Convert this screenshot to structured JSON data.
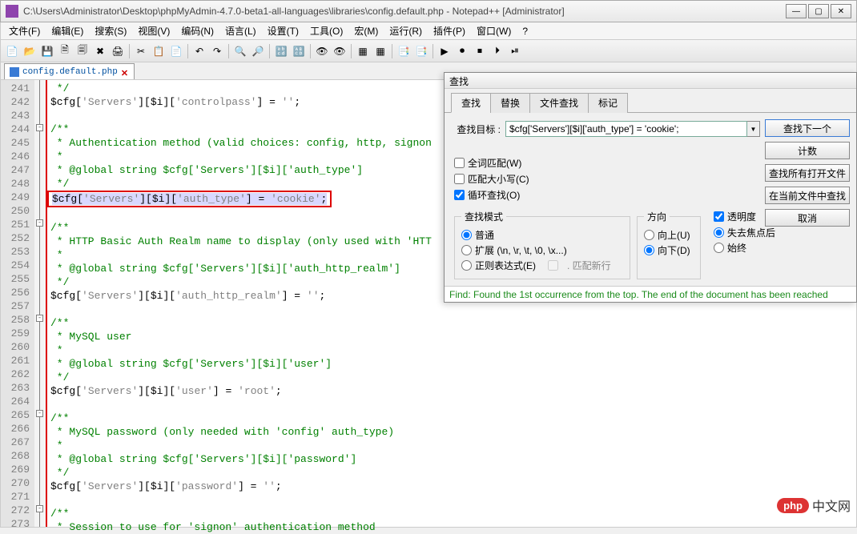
{
  "window": {
    "title": "C:\\Users\\Administrator\\Desktop\\phpMyAdmin-4.7.0-beta1-all-languages\\libraries\\config.default.php - Notepad++ [Administrator]"
  },
  "menu": [
    "文件(F)",
    "编辑(E)",
    "搜索(S)",
    "视图(V)",
    "编码(N)",
    "语言(L)",
    "设置(T)",
    "工具(O)",
    "宏(M)",
    "运行(R)",
    "插件(P)",
    "窗口(W)",
    "?"
  ],
  "tab": {
    "filename": "config.default.php"
  },
  "lines": {
    "start": 241,
    "rows": [
      {
        "n": 241,
        "t": "com",
        "txt": " */"
      },
      {
        "n": 242,
        "t": "code",
        "txt": "$cfg['Servers'][$i]['controlpass'] = '';"
      },
      {
        "n": 243,
        "t": "blank",
        "txt": ""
      },
      {
        "n": 244,
        "t": "com",
        "fold": true,
        "txt": "/**"
      },
      {
        "n": 245,
        "t": "com",
        "txt": " * Authentication method (valid choices: config, http, signon"
      },
      {
        "n": 246,
        "t": "com",
        "txt": " *"
      },
      {
        "n": 247,
        "t": "com",
        "txt": " * @global string $cfg['Servers'][$i]['auth_type']"
      },
      {
        "n": 248,
        "t": "com",
        "txt": " */"
      },
      {
        "n": 249,
        "t": "hl",
        "txt": "$cfg['Servers'][$i]['auth_type'] = 'cookie';"
      },
      {
        "n": 250,
        "t": "blank",
        "txt": ""
      },
      {
        "n": 251,
        "t": "com",
        "fold": true,
        "txt": "/**"
      },
      {
        "n": 252,
        "t": "com",
        "txt": " * HTTP Basic Auth Realm name to display (only used with 'HTT"
      },
      {
        "n": 253,
        "t": "com",
        "txt": " *"
      },
      {
        "n": 254,
        "t": "com",
        "txt": " * @global string $cfg['Servers'][$i]['auth_http_realm']"
      },
      {
        "n": 255,
        "t": "com",
        "txt": " */"
      },
      {
        "n": 256,
        "t": "code",
        "txt": "$cfg['Servers'][$i]['auth_http_realm'] = '';"
      },
      {
        "n": 257,
        "t": "blank",
        "txt": ""
      },
      {
        "n": 258,
        "t": "com",
        "fold": true,
        "txt": "/**"
      },
      {
        "n": 259,
        "t": "com",
        "txt": " * MySQL user"
      },
      {
        "n": 260,
        "t": "com",
        "txt": " *"
      },
      {
        "n": 261,
        "t": "com",
        "txt": " * @global string $cfg['Servers'][$i]['user']"
      },
      {
        "n": 262,
        "t": "com",
        "txt": " */"
      },
      {
        "n": 263,
        "t": "code",
        "txt": "$cfg['Servers'][$i]['user'] = 'root';"
      },
      {
        "n": 264,
        "t": "blank",
        "txt": ""
      },
      {
        "n": 265,
        "t": "com",
        "fold": true,
        "txt": "/**"
      },
      {
        "n": 266,
        "t": "com",
        "txt": " * MySQL password (only needed with 'config' auth_type)"
      },
      {
        "n": 267,
        "t": "com",
        "txt": " *"
      },
      {
        "n": 268,
        "t": "com",
        "txt": " * @global string $cfg['Servers'][$i]['password']"
      },
      {
        "n": 269,
        "t": "com",
        "txt": " */"
      },
      {
        "n": 270,
        "t": "code",
        "txt": "$cfg['Servers'][$i]['password'] = '';"
      },
      {
        "n": 271,
        "t": "blank",
        "txt": ""
      },
      {
        "n": 272,
        "t": "com",
        "fold": true,
        "txt": "/**"
      },
      {
        "n": 273,
        "t": "com",
        "txt": " * Session to use for 'signon' authentication method"
      }
    ]
  },
  "find": {
    "title": "查找",
    "tabs": [
      "查找",
      "替换",
      "文件查找",
      "标记"
    ],
    "target_label": "查找目标 :",
    "target_value": "$cfg['Servers'][$i]['auth_type'] = 'cookie';",
    "buttons": {
      "next": "查找下一个",
      "count": "计数",
      "all_open": "查找所有打开文件",
      "in_current": "在当前文件中查找",
      "close": "取消"
    },
    "checks": {
      "whole": "全词匹配(W)",
      "case": "匹配大小写(C)",
      "wrap": "循环查找(O)"
    },
    "mode": {
      "legend": "查找模式",
      "normal": "普通",
      "ext": "扩展 (\\n, \\r, \\t, \\0, \\x...)",
      "regex": "正则表达式(E)",
      "msnewline": ". 匹配新行"
    },
    "dir": {
      "legend": "方向",
      "up": "向上(U)",
      "down": "向下(D)"
    },
    "trans": {
      "chk": "透明度",
      "afterlose": "失去焦点后",
      "always": "始终"
    },
    "status": "Find: Found the 1st occurrence from the top. The end of the document has been reached"
  },
  "watermark": {
    "logo": "php",
    "text": "中文网"
  }
}
